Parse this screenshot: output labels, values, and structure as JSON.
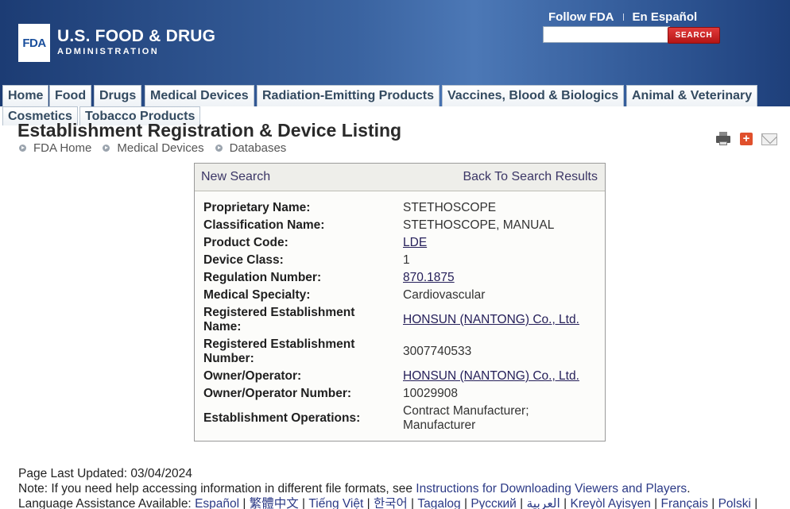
{
  "header": {
    "logo_mark": "FDA",
    "logo_title": "U.S. FOOD & DRUG",
    "logo_subtitle": "ADMINISTRATION",
    "follow_link": "Follow FDA",
    "spanish_link": "En Español",
    "search_placeholder": "",
    "search_button": "SEARCH"
  },
  "nav": {
    "tabs": [
      "Home",
      "Food",
      "Drugs",
      "Medical Devices",
      "Radiation-Emitting Products",
      "Vaccines, Blood & Biologics",
      "Animal & Veterinary",
      "Cosmetics",
      "Tobacco Products"
    ]
  },
  "page": {
    "title": "Establishment Registration & Device Listing",
    "breadcrumb": [
      "FDA Home",
      "Medical Devices",
      "Databases"
    ]
  },
  "icons": [
    "print-icon",
    "share-plus-icon",
    "email-icon"
  ],
  "result": {
    "new_search": "New Search",
    "back_link": "Back To Search Results",
    "fields": [
      {
        "label": "Proprietary Name:",
        "value": "STETHOSCOPE",
        "link": false
      },
      {
        "label": "Classification Name:",
        "value": "STETHOSCOPE, MANUAL",
        "link": false
      },
      {
        "label": "Product Code:",
        "value": "LDE",
        "link": true
      },
      {
        "label": "Device Class:",
        "value": "1",
        "link": false
      },
      {
        "label": "Regulation Number:",
        "value": "870.1875",
        "link": true
      },
      {
        "label": "Medical Specialty:",
        "value": "Cardiovascular",
        "link": false
      },
      {
        "label": "Registered Establishment Name:",
        "value": "HONSUN (NANTONG) Co., Ltd.",
        "link": true
      },
      {
        "label": "Registered Establishment Number:",
        "value": "3007740533",
        "link": false
      },
      {
        "label": "Owner/Operator:",
        "value": "HONSUN (NANTONG) Co., Ltd.",
        "link": true
      },
      {
        "label": "Owner/Operator Number:",
        "value": "10029908",
        "link": false
      },
      {
        "label": "Establishment Operations:",
        "value": "Contract Manufacturer; Manufacturer",
        "link": false
      }
    ]
  },
  "footer": {
    "updated": "Page Last Updated: 03/04/2024",
    "note_prefix": "Note: If you need help accessing information in different file formats, see ",
    "note_link": "Instructions for Downloading Viewers and Players",
    "note_suffix": ".",
    "lang_prefix": "Language Assistance Available: ",
    "languages": [
      "Español",
      "繁體中文",
      "Tiếng Việt",
      "한국어",
      "Tagalog",
      "Русский",
      "العربية",
      "Kreyòl Ayisyen",
      "Français",
      "Polski"
    ]
  }
}
